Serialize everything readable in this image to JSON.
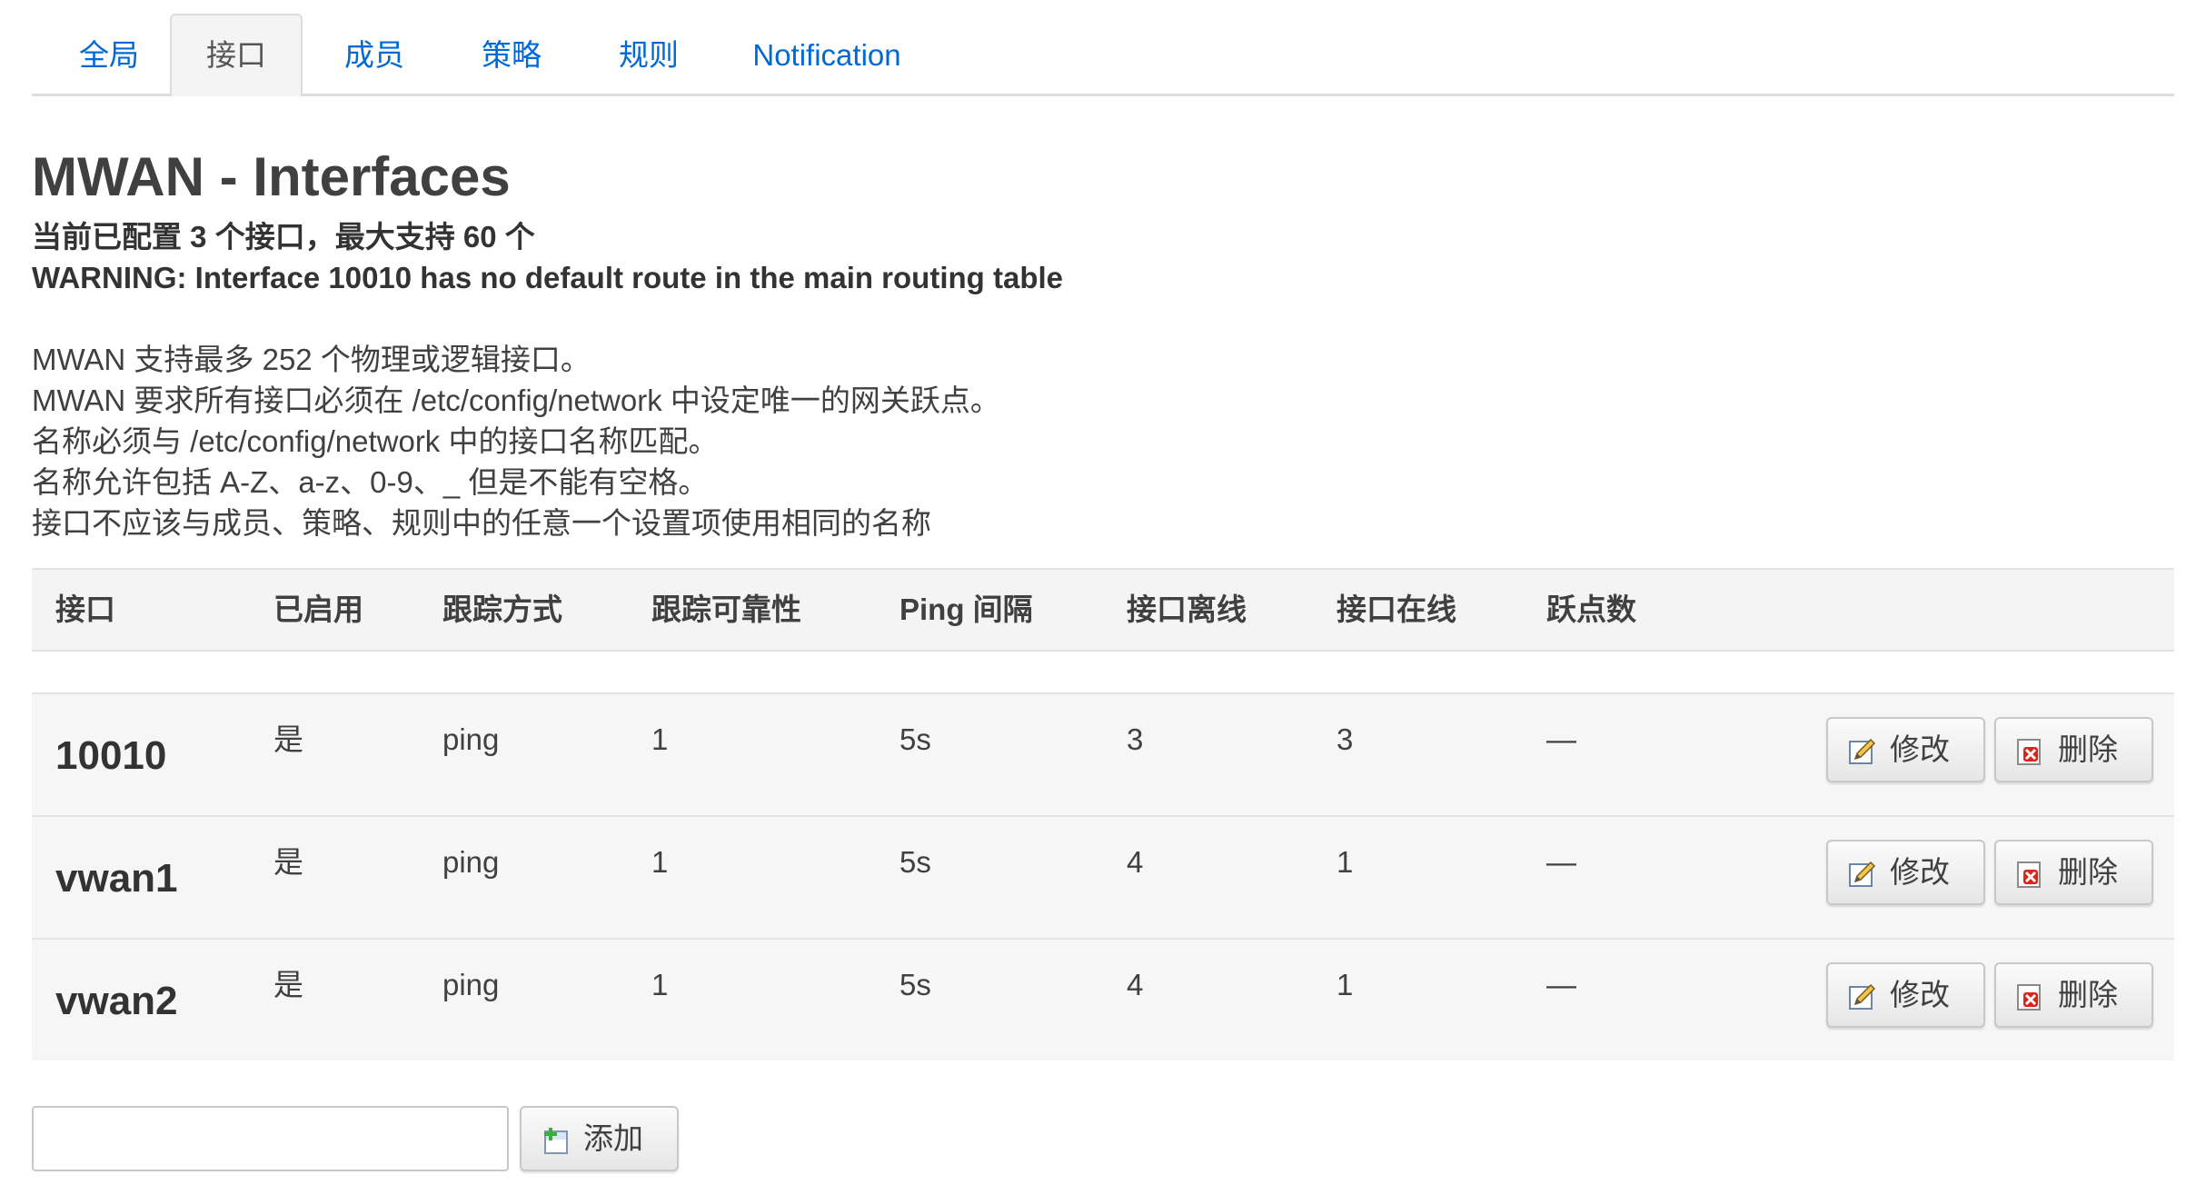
{
  "tabs": [
    "全局",
    "接口",
    "成员",
    "策略",
    "规则",
    "Notification"
  ],
  "active_tab": "接口",
  "title": "MWAN - Interfaces",
  "status_line": "当前已配置 3 个接口，最大支持 60 个",
  "warning_line": "WARNING: Interface 10010 has no default route in the main routing table",
  "description": [
    "MWAN 支持最多 252 个物理或逻辑接口。",
    "MWAN 要求所有接口必须在 /etc/config/network 中设定唯一的网关跃点。",
    "名称必须与 /etc/config/network 中的接口名称匹配。",
    "名称允许包括 A-Z、a-z、0-9、_ 但是不能有空格。",
    "接口不应该与成员、策略、规则中的任意一个设置项使用相同的名称"
  ],
  "table": {
    "headers": [
      "接口",
      "已启用",
      "跟踪方式",
      "跟踪可靠性",
      "Ping 间隔",
      "接口离线",
      "接口在线",
      "跃点数"
    ],
    "rows": [
      {
        "name": "10010",
        "enabled": "是",
        "track_method": "ping",
        "reliability": "1",
        "ping_interval": "5s",
        "down": "3",
        "up": "3",
        "metric": "—"
      },
      {
        "name": "vwan1",
        "enabled": "是",
        "track_method": "ping",
        "reliability": "1",
        "ping_interval": "5s",
        "down": "4",
        "up": "1",
        "metric": "—"
      },
      {
        "name": "vwan2",
        "enabled": "是",
        "track_method": "ping",
        "reliability": "1",
        "ping_interval": "5s",
        "down": "4",
        "up": "1",
        "metric": "—"
      }
    ],
    "edit_label": "修改",
    "delete_label": "删除"
  },
  "add": {
    "input_value": "",
    "button_label": "添加"
  },
  "icons": {
    "edit": "edit-icon",
    "delete": "delete-icon",
    "add": "add-icon"
  },
  "colors": {
    "link": "#0069d6",
    "delete_red": "#d9261c",
    "add_green": "#3cad3c"
  }
}
